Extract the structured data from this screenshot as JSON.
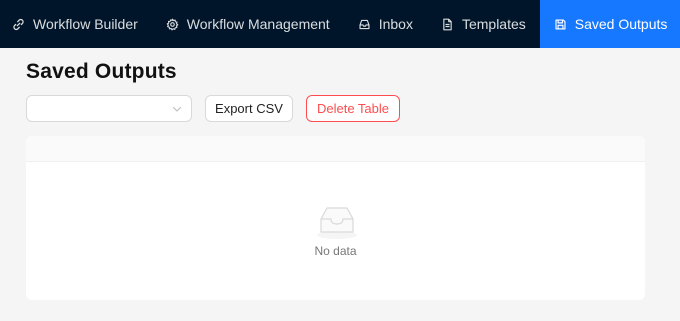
{
  "nav": {
    "items": [
      {
        "label": "Workflow Builder",
        "icon": "link-icon"
      },
      {
        "label": "Workflow Management",
        "icon": "gear-icon"
      },
      {
        "label": "Inbox",
        "icon": "inbox-icon"
      },
      {
        "label": "Templates",
        "icon": "document-icon"
      },
      {
        "label": "Saved Outputs",
        "icon": "save-icon",
        "active": true
      }
    ],
    "more": "···"
  },
  "page": {
    "title": "Saved Outputs"
  },
  "toolbar": {
    "select_value": "",
    "export_label": "Export CSV",
    "delete_label": "Delete Table"
  },
  "table": {
    "empty_text": "No data"
  },
  "colors": {
    "nav_bg": "#001529",
    "accent": "#1677ff",
    "danger": "#ff4d4f"
  }
}
